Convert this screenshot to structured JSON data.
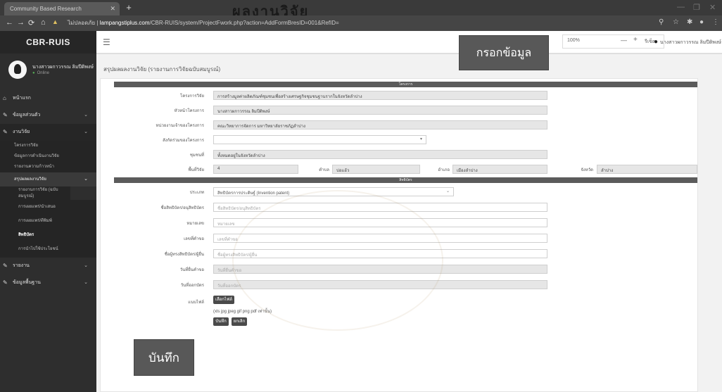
{
  "browser": {
    "tab_title": "Community Based Research",
    "url_secure": "ไม่ปลอดภัย",
    "url_host": "lampangstiplus.com",
    "url_path": "/CBR-RUIS/system/ProjectFwork.php?action=AddFormBresID=001&RefID="
  },
  "window_title": "ผลงานวิจัย",
  "app": {
    "brand": "CBR-RUIS"
  },
  "user": {
    "name": "นางสาวผกาวรรณ ลิมปีติพงษ์",
    "status": "Online"
  },
  "sidebar": {
    "items": [
      {
        "label": "หน้าแรก",
        "icon": "home-icon"
      },
      {
        "label": "ข้อมูลส่วนตัว",
        "icon": "edit-icon"
      },
      {
        "label": "งานวิจัย",
        "icon": "edit-icon"
      }
    ],
    "research_sub": [
      "โครงการวิจัย",
      "ข้อมูลการดำเนินงานวิจัย",
      "รายงานความก้าวหน้า",
      "สรุปผลผลงานวิจัย"
    ],
    "result_sub": [
      "รายงานการวิจัย (ฉบับสมบูรณ์)",
      "การเผยแพร่/นำเสนอ",
      "การเผยแพร่/ตีพิมพ์",
      "สิทธิบัตร",
      "การนำไปใช้ประโยชน์"
    ],
    "bottom_items": [
      {
        "label": "รายงาน",
        "icon": "edit-icon"
      },
      {
        "label": "ข้อมูลพื้นฐาน",
        "icon": "edit-icon"
      }
    ]
  },
  "topbar": {
    "zoom_value": "100%",
    "zoom_reset": "รีเซ็ต",
    "user_short": "นางสาวผกาวรรณ ลิมปีติพงษ์"
  },
  "page_title": "สรุปผลผลงานวิจัย (รายงานการวิจัยฉบับสมบูรณ์)",
  "project_header": {
    "title": "โครงการ"
  },
  "project": {
    "name_label": "โครงการวิจัย",
    "name_value": "การสร้างมูลค่าผลิตภัณฑ์ชุมชนเพื่อสร้างเศรษฐกิจชุมชนฐานรากในจังหวัดลำปาง",
    "leader_label": "หัวหน้าโครงการ",
    "leader_value": "นางสาวผกาวรรณ ลิมปีติพงษ์",
    "agency_label": "หน่วยงานเจ้าของโครงการ",
    "agency_value": "คณะวิทยาการจัดการ มหาวิทยาลัยราชภัฏลำปาง",
    "coowner_label": "สังกัดร่วมของโครงการ",
    "area_label": "ชุมชนที่",
    "area_value": "ทั้งหมดอยู่ในจังหวัดลำปาง",
    "location_label": "พื้นที่วิจัย",
    "village_no": "4",
    "subdistrict_label": "ตำบล",
    "subdistrict_value": "บ่อแฮ้ว",
    "district_label": "อำเภอ",
    "district_value": "เมืองลำปาง",
    "province_label": "จังหวัด",
    "province_value": "ลำปาง"
  },
  "patent_header": {
    "title": "สิทธิบัตร"
  },
  "patent": {
    "type_label": "ประเภท",
    "type_value": "สิทธิบัตรการประดิษฐ์ (Invention patent)",
    "name_label": "ชื่อสิทธิบัตร/อนุสิทธิบัตร",
    "name_placeholder": "ชื่อสิทธิบัตร/อนุสิทธิบัตร",
    "number_label": "หมายเลข",
    "number_placeholder": "หมายเลข",
    "request_no_label": "เลขที่คำขอ",
    "request_no_placeholder": "เลขที่คำขอ",
    "owner_label": "ชื่อผู้ทรงสิทธิบัตร/ผู้ยื่น",
    "owner_placeholder": "ชื่อผู้ทรงสิทธิบัตร/ผู้ยื่น",
    "file_date_label": "วันที่ยื่นคำขอ",
    "file_date_placeholder": "วันที่ยื่นคำขอ",
    "grant_date_label": "วันที่ออกบัตร",
    "grant_date_placeholder": "วันที่ออกบัตร",
    "attach_label": "แนบไฟล์",
    "attach_button": "เลือกไฟล์",
    "file_types": "(xls jpg jpeg gif png pdf เท่านั้น)",
    "save_button": "บันทึก",
    "cancel_button": "ยกเลิก"
  },
  "annotations": {
    "fill_data": "กรอกข้อมูล",
    "save": "บันทึก"
  }
}
